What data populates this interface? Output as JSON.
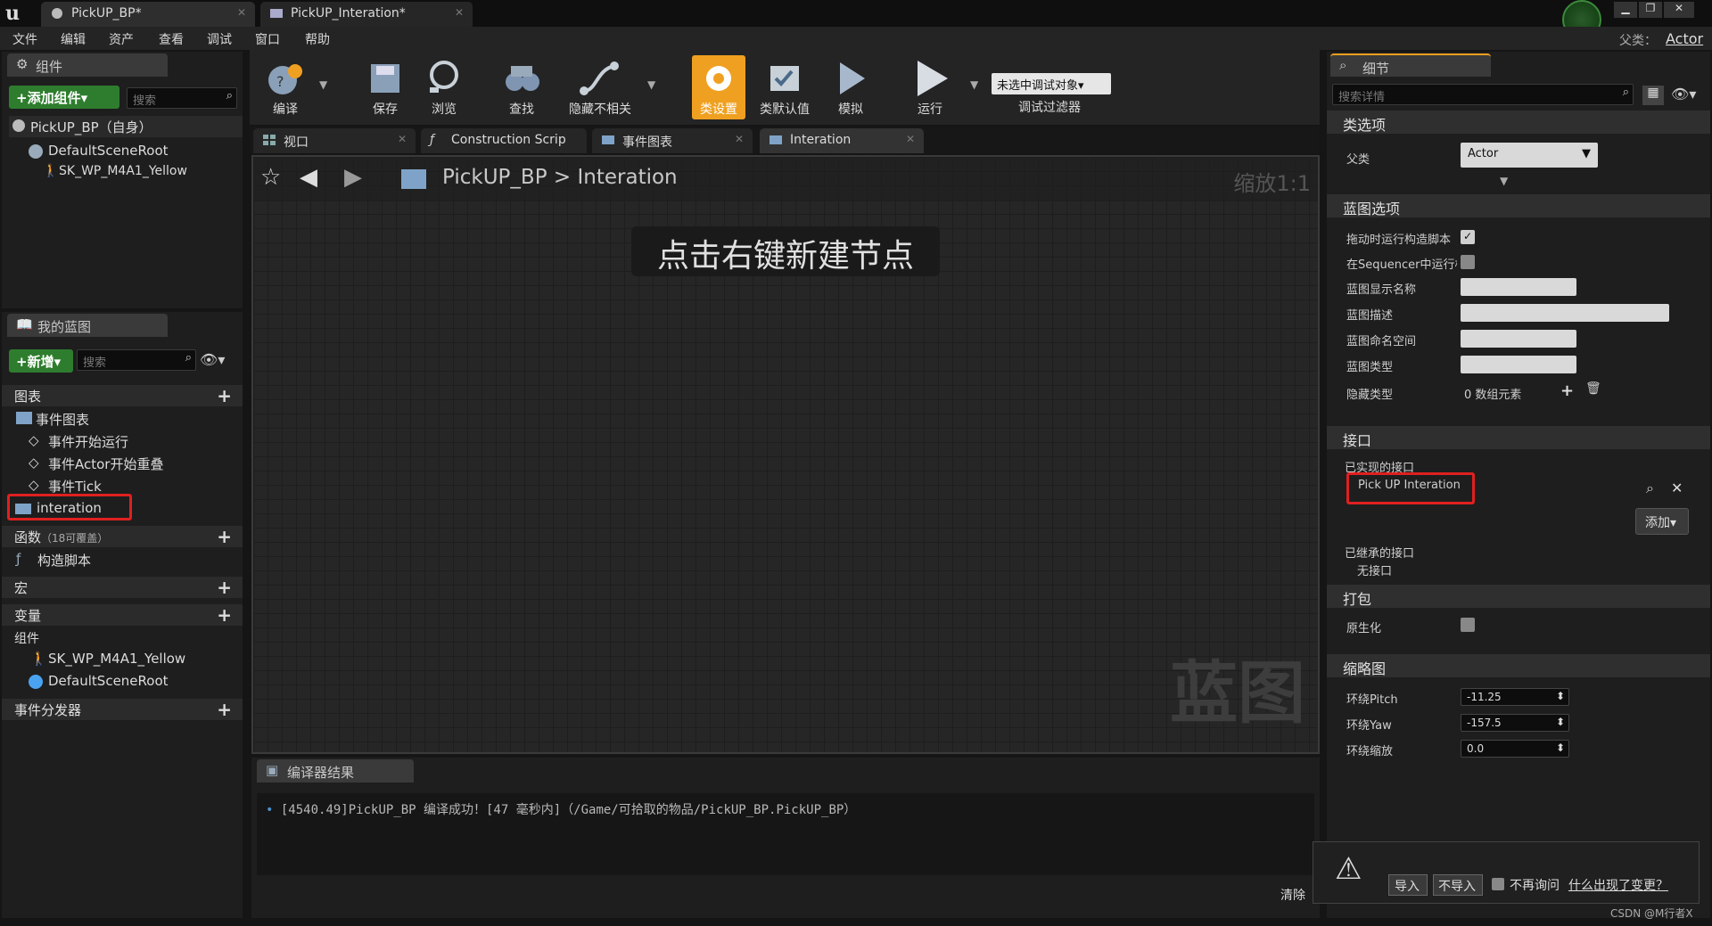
{
  "window": {
    "tabs": [
      {
        "label": "PickUP_BP*"
      },
      {
        "label": "PickUP_Interation*"
      }
    ],
    "parent_label": "父类：",
    "parent_value": "Actor"
  },
  "menu": [
    "文件",
    "编辑",
    "资产",
    "查看",
    "调试",
    "窗口",
    "帮助"
  ],
  "components_panel": {
    "title": "组件",
    "add_button": "+添加组件▾",
    "search_placeholder": "搜索",
    "root": "PickUP_BP（自身）",
    "items": [
      "DefaultSceneRoot",
      "SK_WP_M4A1_Yellow"
    ]
  },
  "my_blueprint": {
    "title": "我的蓝图",
    "new_button": "+新增▾",
    "search_placeholder": "搜索",
    "graphs_label": "图表",
    "event_graph": "事件图表",
    "events": [
      "事件开始运行",
      "事件Actor开始重叠",
      "事件Tick"
    ],
    "interation": "interation",
    "functions_label": "函数",
    "functions_note": "（18可覆盖）",
    "construction": "构造脚本",
    "macros_label": "宏",
    "variables_label": "变量",
    "components_label": "组件",
    "var_components": [
      "SK_WP_M4A1_Yellow",
      "DefaultSceneRoot"
    ],
    "dispatchers_label": "事件分发器"
  },
  "toolbar": {
    "compile": "编译",
    "save": "保存",
    "browse": "浏览",
    "find": "查找",
    "hide_unrelated": "隐藏不相关",
    "class_settings": "类设置",
    "class_defaults": "类默认值",
    "simulate": "模拟",
    "run": "运行",
    "debug_object": "未选中调试对象▾",
    "debug_filter": "调试过滤器"
  },
  "graph_tabs": [
    {
      "label": "视口"
    },
    {
      "label": "Construction Scrip"
    },
    {
      "label": "事件图表"
    },
    {
      "label": "Interation"
    }
  ],
  "graph": {
    "breadcrumb_root": "PickUP_BP",
    "breadcrumb_sep": ">",
    "breadcrumb_current": "Interation",
    "zoom": "缩放1:1",
    "hint": "点击右键新建节点",
    "watermark": "蓝图"
  },
  "compiler": {
    "title": "编译器结果",
    "message": "[4540.49]PickUP_BP 编译成功！[47 毫秒内]（/Game/可拾取的物品/PickUP_BP.PickUP_BP）",
    "clear": "清除"
  },
  "details": {
    "title": "细节",
    "search_placeholder": "搜索详情",
    "class_options": "类选项",
    "parent_class_label": "父类",
    "parent_class_value": "Actor",
    "blueprint_options": "蓝图选项",
    "rows": [
      "拖动时运行构造脚本",
      "在Sequencer中运行构",
      "蓝图显示名称",
      "蓝图描述",
      "蓝图命名空间",
      "蓝图类型",
      "隐藏类型"
    ],
    "hidden_type_value": "0 数组元素",
    "interfaces": "接口",
    "implemented": "已实现的接口",
    "implemented_item": "Pick UP Interation",
    "add_button": "添加▾",
    "inherited": "已继承的接口",
    "no_interface": "无接口",
    "packaging": "打包",
    "nativize": "原生化",
    "thumbnail": "缩略图",
    "orbit_pitch_label": "环绕Pitch",
    "orbit_pitch": "-11.25",
    "orbit_yaw_label": "环绕Yaw",
    "orbit_yaw": "-157.5",
    "orbit_zoom_label": "环绕缩放",
    "orbit_zoom": "0.0"
  },
  "notification": {
    "import": "导入",
    "no_import": "不导入",
    "dont_ask": "不再询问",
    "what_changed": "什么出现了变更？"
  },
  "watermark": "CSDN @M行者X",
  "colors": {
    "accent": "#f0a020",
    "highlight": "#e02020",
    "green": "#2e7d2e"
  }
}
